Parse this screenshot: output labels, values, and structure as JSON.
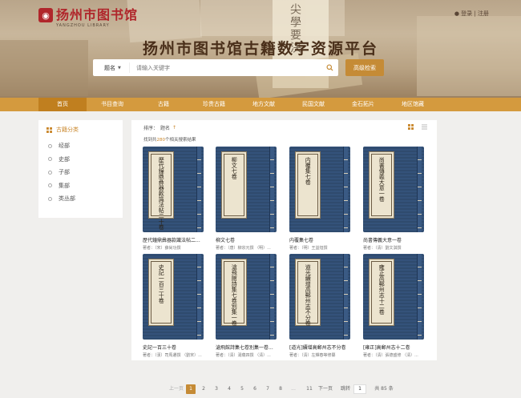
{
  "header": {
    "logo_text": "扬州市图书馆",
    "logo_sub": "YANGZHOU LIBRARY",
    "top_links": "● 登录 | 注册",
    "main_title": "扬州市图书馆古籍数字资源平台",
    "banner_scroll_text": "尖學要決"
  },
  "search": {
    "scope": "题名",
    "placeholder": "请输入关键字",
    "advanced_label": "高级检索"
  },
  "nav": {
    "items": [
      {
        "label": "首页"
      },
      {
        "label": "书目查询"
      },
      {
        "label": "古籍"
      },
      {
        "label": "珍贵古籍"
      },
      {
        "label": "地方文献"
      },
      {
        "label": "民国文献"
      },
      {
        "label": "金石拓片"
      },
      {
        "label": "地区馆藏"
      }
    ],
    "active_index": 0
  },
  "sidebar": {
    "title": "古籍分类",
    "items": [
      {
        "label": "经部"
      },
      {
        "label": "史部"
      },
      {
        "label": "子部"
      },
      {
        "label": "集部"
      },
      {
        "label": "类丛部"
      }
    ]
  },
  "results": {
    "sort_label": "排序：",
    "sort_field": "题名",
    "sort_arrow": "↑",
    "count_prefix": "找到共",
    "count": "280",
    "count_suffix": "个相关搜索结果"
  },
  "books": [
    {
      "cover": "歷代鐘鼎彝器款識法帖二十卷",
      "title": "歷代鐘鼎彝器款識法帖二...",
      "author": "著者：（宋）薛尚功撰"
    },
    {
      "cover": "柳文七卷",
      "title": "柳文七卷",
      "author": "著者：（唐）柳宗元撰 （明）..."
    },
    {
      "cover": "内覆集七卷",
      "title": "内覆集七卷",
      "author": "著者：（明）王益烜撰"
    },
    {
      "cover": "尚書傳義大意一卷",
      "title": "尚書傳義大意一卷",
      "author": "著者：（清）劉文淇撰"
    },
    {
      "cover": "史記一百三十卷",
      "title": "史記一百三十卷",
      "author": "著者：（漢）司馬遷撰 （劉宋）..."
    },
    {
      "cover": "滄飛館詩集七卷別集一卷",
      "title": "滄飛館詩集七卷別集一卷...",
      "author": "著者：（清）湯藴四撰 （清）..."
    },
    {
      "cover": "道光續增高郵州志不分卷",
      "title": "[道光]續增高郵州志不分卷",
      "author": "著者：（清）左輝春等修纂"
    },
    {
      "cover": "雍正高郵州志十二卷",
      "title": "[雍正]高郵州志十二卷",
      "author": "著者：（清）張德盛修 （清）..."
    }
  ],
  "pagination": {
    "prev": "上一页",
    "pages": [
      "1",
      "2",
      "3",
      "4",
      "5",
      "6",
      "7",
      "8",
      "...",
      "11"
    ],
    "current": "1",
    "next": "下一页",
    "jump_label": "跳转",
    "jump_value": "1",
    "total": "共 85 条"
  },
  "colors": {
    "accent": "#d49a3e",
    "accent_dark": "#c07f1f",
    "brand_red": "#b0262b",
    "book_blue": "#2f4b6e"
  }
}
